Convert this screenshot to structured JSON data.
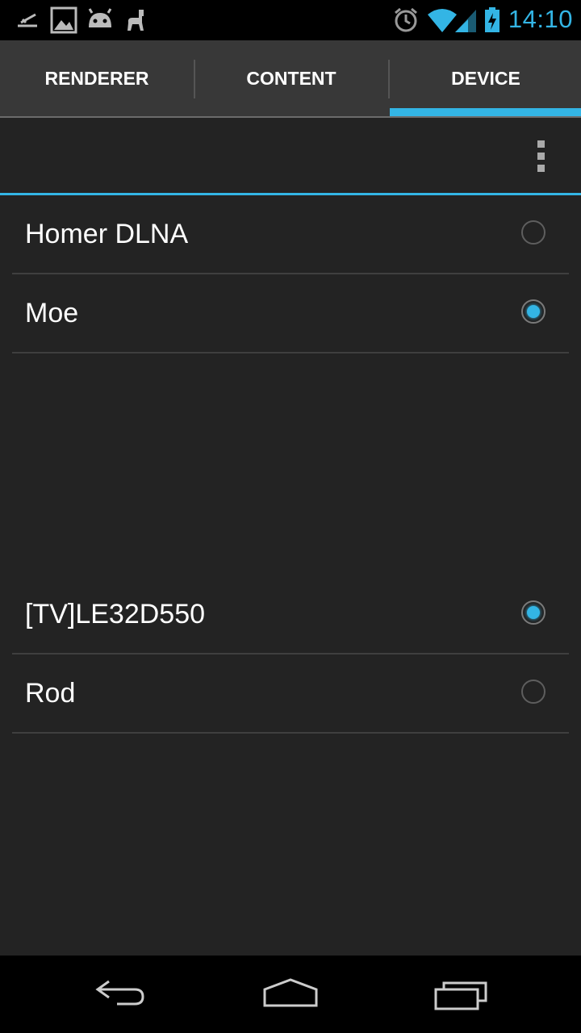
{
  "status_bar": {
    "time": "14:10",
    "icons": [
      "usb-debug-icon",
      "image-icon",
      "android-icon",
      "llama-icon",
      "alarm-icon",
      "wifi-icon",
      "signal-icon",
      "battery-charging-icon"
    ]
  },
  "tabs": [
    {
      "label": "RENDERER",
      "selected": false
    },
    {
      "label": "CONTENT",
      "selected": false
    },
    {
      "label": "DEVICE",
      "selected": true
    }
  ],
  "devices_group_1": [
    {
      "label": "Homer DLNA",
      "checked": false
    },
    {
      "label": "Moe",
      "checked": true
    }
  ],
  "devices_group_2": [
    {
      "label": "[TV]LE32D550",
      "checked": true
    },
    {
      "label": "Rod",
      "checked": false
    }
  ],
  "colors": {
    "accent": "#33b5e5",
    "background": "#232323",
    "tab_bar": "#383838"
  },
  "nav_bar": [
    "back-icon",
    "home-icon",
    "recents-icon"
  ]
}
